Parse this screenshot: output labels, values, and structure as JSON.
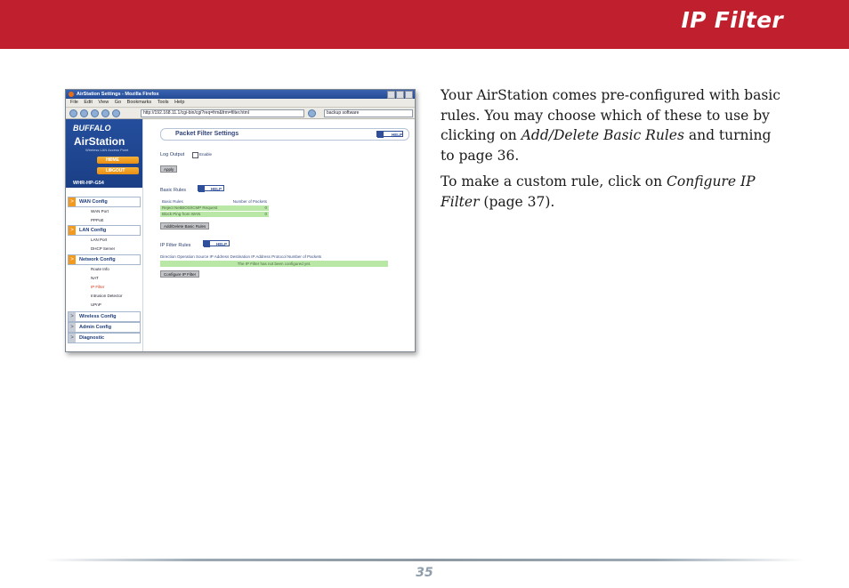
{
  "header": {
    "title": "IP Filter"
  },
  "body": {
    "p1_a": "Your AirStation comes pre-configured with basic rules.  You may choose which of these to use by clicking on ",
    "p1_em": "Add/Delete Basic Rules",
    "p1_b": " and turning to page 36.",
    "p2_a": "To make a custom rule, click on ",
    "p2_em": "Configure IP Filter",
    "p2_b": " (page 37)."
  },
  "footer": {
    "page_number": "35"
  },
  "screenshot": {
    "window_title": "AirStation Settings - Mozilla Firefox",
    "menu": [
      "File",
      "Edit",
      "View",
      "Go",
      "Bookmarks",
      "Tools",
      "Help"
    ],
    "url": "http://192.168.11.1/cgi-bin/cgi?req=frm&frm=filter.html",
    "search": "backup software",
    "brand": {
      "logo": "BUFFALO",
      "product": "AirStation",
      "sub": "Wireless LAN Access Point",
      "home": "HOME",
      "logout": "LOGOUT",
      "model": "WHR-HP-G54"
    },
    "nav": {
      "wan": "WAN Config",
      "wan_port": "WAN Port",
      "pppoe": "PPPoE",
      "lan": "LAN Config",
      "lan_port": "LAN Port",
      "dhcp": "DHCP Server",
      "network": "Network Config",
      "route": "Route Info",
      "nat": "NAT",
      "ipfilter": "IP Filter",
      "intrusion": "Intrusion Detector",
      "upnp": "UPnP",
      "wireless": "Wireless Config",
      "admin": "Admin Config",
      "diag": "Diagnostic"
    },
    "content": {
      "title": "Packet Filter Settings",
      "help": "HELP",
      "log_output": "Log Output",
      "enable": "Enable",
      "apply": "Apply",
      "basic_rules": "Basic Rules",
      "col_basic": "Basic Rules",
      "col_packets": "Number of Packets",
      "rule1": "Reject NetBIOS/ICMP Request",
      "rule1_count": "0",
      "rule2": "Block Ping from WAN",
      "rule2_count": "0",
      "add_delete": "Add/Delete Basic Rules",
      "ipf_rules": "IP Filter Rules",
      "ipf_header": "Direction Operation Source IP Address Destination IP Address Protocol Number of Packets",
      "ipf_empty": "The IP Filter has not been configured yet.",
      "configure": "Configure IP Filter"
    }
  }
}
